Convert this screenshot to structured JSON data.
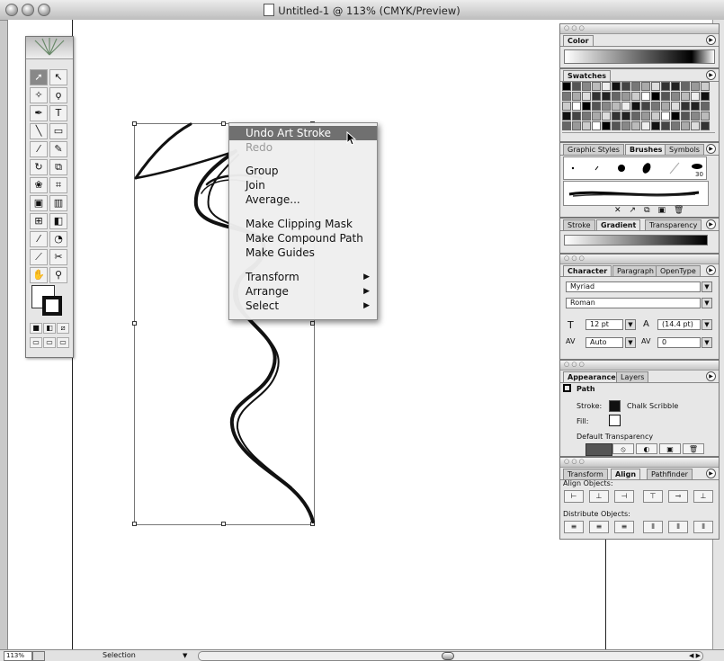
{
  "window": {
    "title": "Untitled-1 @ 113% (CMYK/Preview)"
  },
  "status": {
    "zoom": "113%",
    "mode": "Selection"
  },
  "context_menu": {
    "items": [
      {
        "label": "Undo Art Stroke",
        "state": "highlighted"
      },
      {
        "label": "Redo",
        "state": "disabled"
      },
      {
        "label": "Group"
      },
      {
        "label": "Join"
      },
      {
        "label": "Average..."
      },
      {
        "label": "Make Clipping Mask"
      },
      {
        "label": "Make Compound Path"
      },
      {
        "label": "Make Guides"
      },
      {
        "label": "Transform",
        "submenu": true
      },
      {
        "label": "Arrange",
        "submenu": true
      },
      {
        "label": "Select",
        "submenu": true
      }
    ],
    "arrow_glyph": "▶"
  },
  "panels": {
    "color": {
      "tab": "Color"
    },
    "swatches": {
      "tab": "Swatches"
    },
    "brushes": {
      "tabs": [
        "Graphic Styles",
        "Brushes",
        "Symbols"
      ],
      "size_label": "30"
    },
    "stroke": {
      "tabs": [
        "Stroke",
        "Gradient",
        "Transparency"
      ]
    },
    "character": {
      "tabs": [
        "Character",
        "Paragraph",
        "OpenType"
      ],
      "font": "Myriad",
      "style": "Roman",
      "size": "12 pt",
      "leading": "(14.4 pt)",
      "kerning": "Auto",
      "tracking": "0"
    },
    "appearance": {
      "tabs": [
        "Appearance",
        "Layers"
      ],
      "object": "Path",
      "stroke_label": "Stroke:",
      "stroke_value": "Chalk Scribble",
      "fill_label": "Fill:",
      "transparency": "Default Transparency"
    },
    "align": {
      "tabs": [
        "Transform",
        "Align",
        "Pathfinder"
      ],
      "align_label": "Align Objects:",
      "distribute_label": "Distribute Objects:"
    }
  },
  "colors": {
    "highlight": "#707070",
    "panel_bg": "#e7e7e7"
  }
}
